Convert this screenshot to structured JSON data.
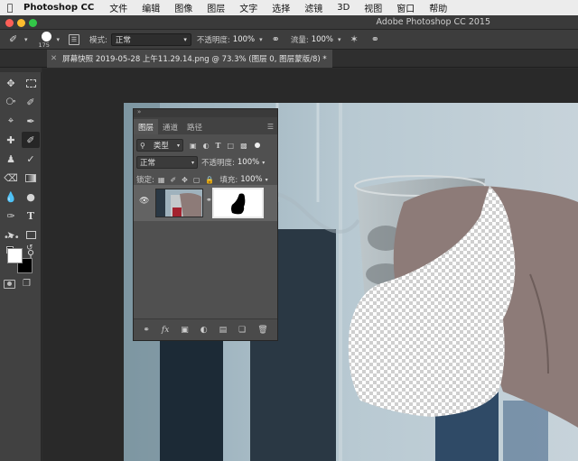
{
  "menubar": {
    "app_name": "Photoshop CC",
    "items": [
      "文件",
      "编辑",
      "图像",
      "图层",
      "文字",
      "选择",
      "滤镜",
      "3D",
      "视图",
      "窗口",
      "帮助"
    ]
  },
  "window": {
    "title": "Adobe Photoshop CC 2015"
  },
  "options": {
    "brush_size": "175",
    "mode_label": "模式:",
    "mode_value": "正常",
    "opacity_label": "不透明度:",
    "opacity_value": "100%",
    "flow_label": "流量:",
    "flow_value": "100%"
  },
  "document": {
    "tab_title": "屏幕快照 2019-05-28 上午11.29.14.png @ 73.3% (图层 0, 图层蒙版/8) *"
  },
  "layers_panel": {
    "tabs": [
      "图层",
      "通道",
      "路径"
    ],
    "filter_type": "类型",
    "blend_mode": "正常",
    "opacity_label": "不透明度:",
    "opacity_value": "100%",
    "lock_label": "锁定:",
    "fill_label": "填充:",
    "fill_value": "100%",
    "footer_fx": "fx"
  },
  "colors": {
    "ui_dark": "#2c2c2c",
    "panel": "#505050",
    "selected_layer": "#636363",
    "traffic_red": "#fc5f57",
    "traffic_yellow": "#fdbc2e",
    "traffic_green": "#33c748"
  }
}
